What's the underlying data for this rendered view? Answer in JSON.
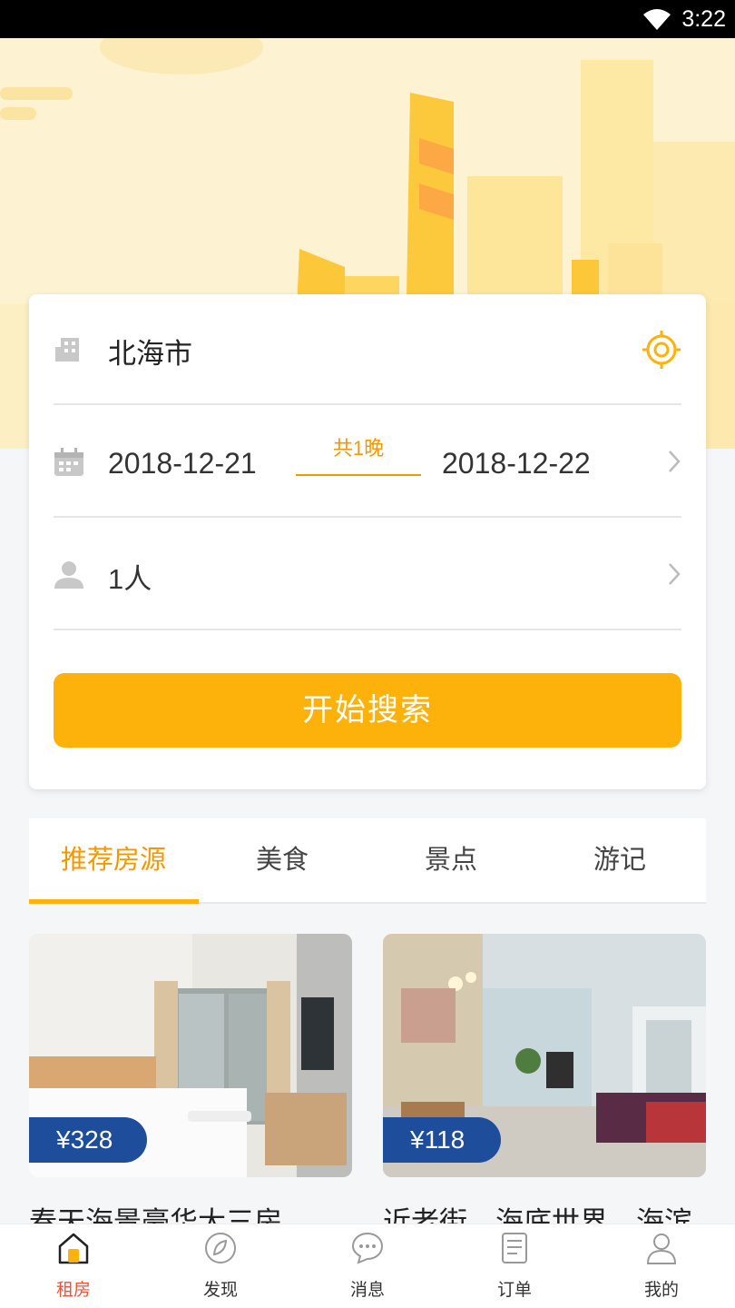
{
  "status_bar": {
    "time": "3:22"
  },
  "search": {
    "city": "北海市",
    "checkin": "2018-12-21",
    "nights": "共1晚",
    "checkout": "2018-12-22",
    "guests": "1人",
    "button_label": "开始搜索"
  },
  "tabs": [
    {
      "label": "推荐房源",
      "active": true
    },
    {
      "label": "美食"
    },
    {
      "label": "景点"
    },
    {
      "label": "游记"
    }
  ],
  "listings": [
    {
      "price": "¥328",
      "title": "春天海景豪华大三房"
    },
    {
      "price": "¥118",
      "title": "近老街、海底世界、海滨"
    }
  ],
  "bottom_nav": [
    {
      "label": "租房",
      "icon": "home-icon",
      "active": true
    },
    {
      "label": "发现",
      "icon": "compass-icon"
    },
    {
      "label": "消息",
      "icon": "chat-icon"
    },
    {
      "label": "订单",
      "icon": "order-icon"
    },
    {
      "label": "我的",
      "icon": "user-icon"
    }
  ],
  "colors": {
    "accent": "#fcb10b",
    "accent_text": "#f39800",
    "price_tag": "#1e4d9b",
    "nav_active": "#e8553a"
  }
}
